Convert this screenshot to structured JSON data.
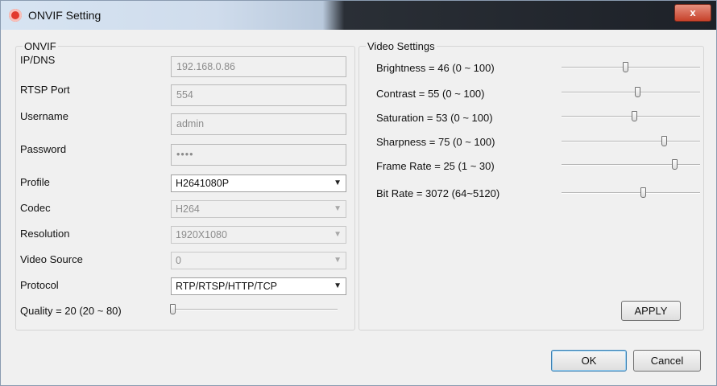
{
  "window": {
    "title": "ONVIF Setting",
    "close_glyph": "x",
    "icon": "app-logo-icon"
  },
  "onvif": {
    "legend": "ONVIF",
    "ip_label": "IP/DNS",
    "ip_value": "192.168.0.86",
    "rtsp_label": "RTSP Port",
    "rtsp_value": "554",
    "user_label": "Username",
    "user_value": "admin",
    "pass_label": "Password",
    "pass_value": "••••",
    "profile_label": "Profile",
    "profile_value": "H2641080P",
    "codec_label": "Codec",
    "codec_value": "H264",
    "resolution_label": "Resolution",
    "resolution_value": "1920X1080",
    "source_label": "Video Source",
    "source_value": "0",
    "protocol_label": "Protocol",
    "protocol_value": "RTP/RTSP/HTTP/TCP",
    "quality_label": "Quality = 20 (20 ~ 80)"
  },
  "video": {
    "legend": "Video Settings",
    "brightness_label": "Brightness = 46 (0 ~ 100)",
    "contrast_label": "Contrast = 55 (0 ~ 100)",
    "saturation_label": "Saturation = 53 (0 ~ 100)",
    "sharpness_label": "Sharpness = 75 (0 ~ 100)",
    "framerate_label": "Frame Rate = 25 (1 ~ 30)",
    "bitrate_label": "Bit Rate = 3072 (64~5120)",
    "apply_label": "APPLY"
  },
  "sliders": {
    "quality": {
      "value": 20,
      "min": 20,
      "max": 80
    },
    "brightness": {
      "value": 46,
      "min": 0,
      "max": 100
    },
    "contrast": {
      "value": 55,
      "min": 0,
      "max": 100
    },
    "saturation": {
      "value": 53,
      "min": 0,
      "max": 100
    },
    "sharpness": {
      "value": 75,
      "min": 0,
      "max": 100
    },
    "framerate": {
      "value": 25,
      "min": 1,
      "max": 30
    },
    "bitrate": {
      "value": 3072,
      "min": 64,
      "max": 5120
    }
  },
  "footer": {
    "ok_label": "OK",
    "cancel_label": "Cancel"
  }
}
